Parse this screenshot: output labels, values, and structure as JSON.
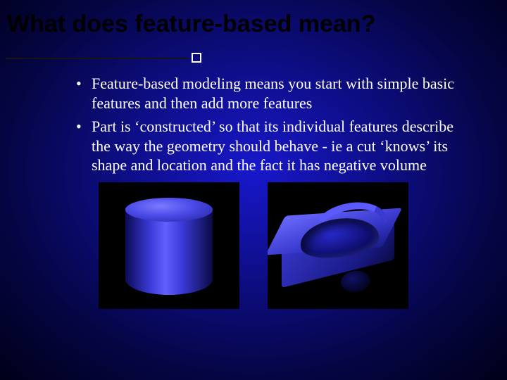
{
  "title": "What does feature-based mean?",
  "bullets": [
    "Feature-based modeling means you start with simple basic features and then add more features",
    "Part is ‘constructed’ so that its individual features describe the way the geometry should behave - ie a cut ‘knows’ its shape and location and the fact it has negative volume"
  ]
}
